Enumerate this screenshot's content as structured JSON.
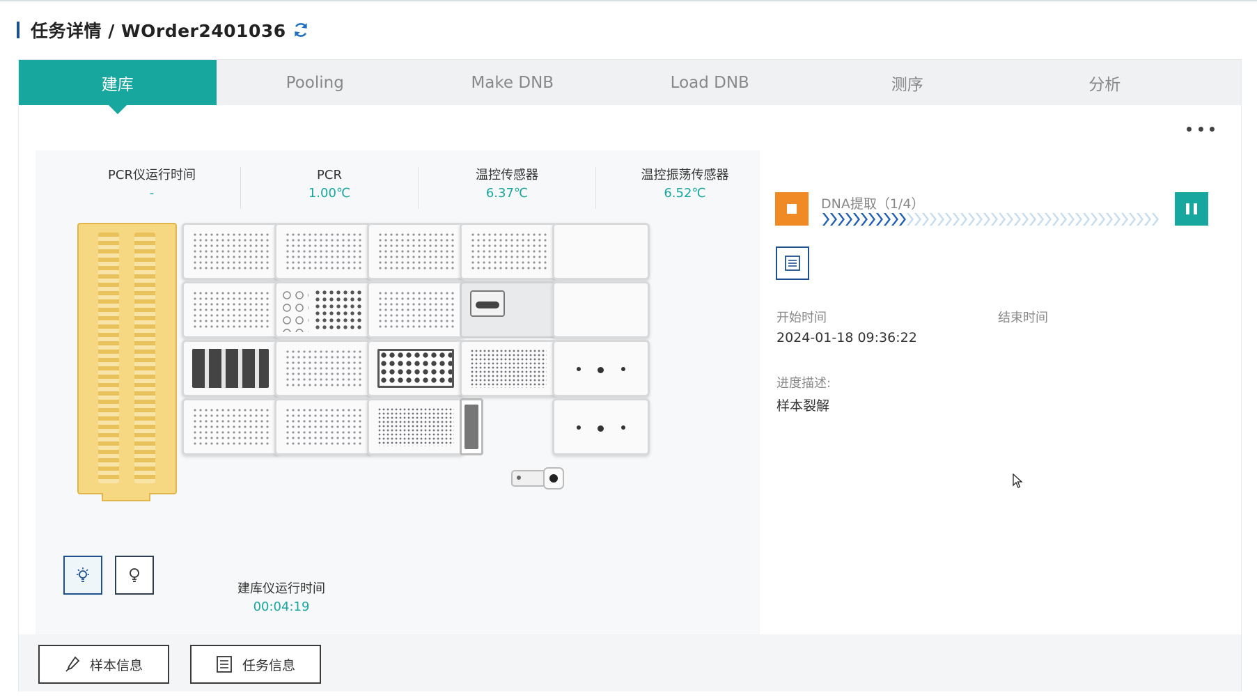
{
  "header": {
    "title": "任务详情 / WOrder2401036",
    "refresh_icon": "refresh-icon"
  },
  "tabs": [
    {
      "label": "建库",
      "active": true
    },
    {
      "label": "Pooling",
      "active": false
    },
    {
      "label": "Make DNB",
      "active": false
    },
    {
      "label": "Load DNB",
      "active": false
    },
    {
      "label": "测序",
      "active": false
    },
    {
      "label": "分析",
      "active": false
    }
  ],
  "sensors": [
    {
      "label": "PCR仪运行时间",
      "value": "-"
    },
    {
      "label": "PCR",
      "value": "1.00℃"
    },
    {
      "label": "温控传感器",
      "value": "6.37℃"
    },
    {
      "label": "温控振荡传感器",
      "value": "6.52℃"
    }
  ],
  "runtime": {
    "label": "建库仪运行时间",
    "value": "00:04:19"
  },
  "status": {
    "step_label": "DNA提取（1/4）",
    "progress_fraction": 0.25,
    "start_time_label": "开始时间",
    "start_time_value": "2024-01-18 09:36:22",
    "end_time_label": "结束时间",
    "end_time_value": "",
    "progress_desc_label": "进度描述:",
    "progress_desc_value": "样本裂解"
  },
  "buttons": {
    "sample_info": "样本信息",
    "task_info": "任务信息"
  },
  "colors": {
    "accent": "#17a79e",
    "stop": "#f08a24",
    "progress_done": "#1e5fb0",
    "progress_todo": "#c5dcef",
    "header_bar": "#1e4f8f"
  }
}
